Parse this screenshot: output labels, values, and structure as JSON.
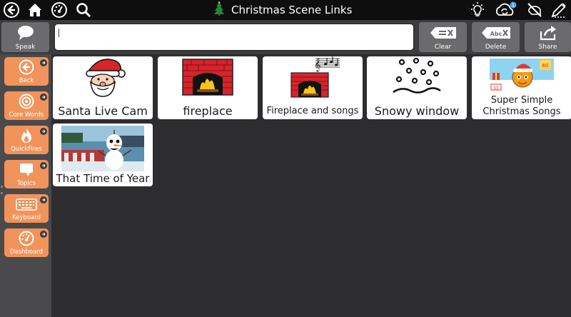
{
  "header": {
    "title": "Christmas Scene Links",
    "left_icons": [
      "back-icon",
      "home-icon",
      "dashboard-icon",
      "search-icon"
    ],
    "right_icons": [
      "lightbulb-icon",
      "sync-icon",
      "hide-icon",
      "edit-icon"
    ]
  },
  "toolbar": {
    "speak_label": "Speak",
    "message_value": "",
    "clear_label": "Clear",
    "delete_label": "Delete",
    "share_label": "Share"
  },
  "sidebar": {
    "items": [
      {
        "label": "Back",
        "icon": "back-arrow-icon"
      },
      {
        "label": "Core Words",
        "icon": "target-icon"
      },
      {
        "label": "QuickFires",
        "icon": "fire-icon"
      },
      {
        "label": "Topics",
        "icon": "speech-bubble-icon"
      },
      {
        "label": "Keyboard",
        "icon": "keyboard-icon"
      },
      {
        "label": "Dashboard",
        "icon": "gauge-icon"
      }
    ]
  },
  "tiles": [
    {
      "label": "Santa Live Cam",
      "icon": "santa-icon"
    },
    {
      "label": "fireplace",
      "icon": "fireplace-icon"
    },
    {
      "label": "Fireplace and songs",
      "icon": "fireplace-music-icon"
    },
    {
      "label": "Snowy window",
      "icon": "snow-icon"
    },
    {
      "label": "Super Simple Christmas Songs",
      "label_line1": "Super Simple",
      "label_line2": "Christmas Songs",
      "icon": "super-simple-thumbnail"
    },
    {
      "label": "That Time of Year",
      "icon": "olaf-thumbnail"
    }
  ],
  "colors": {
    "topbar": "#0e0e0e",
    "toolbar": "#3c3c3e",
    "toolbar_button": "#6b6b6d",
    "sidebar": "#4a4a4c",
    "nav_button": "#f2935b",
    "workspace": "#2d2d2f",
    "tile": "#ffffff"
  }
}
